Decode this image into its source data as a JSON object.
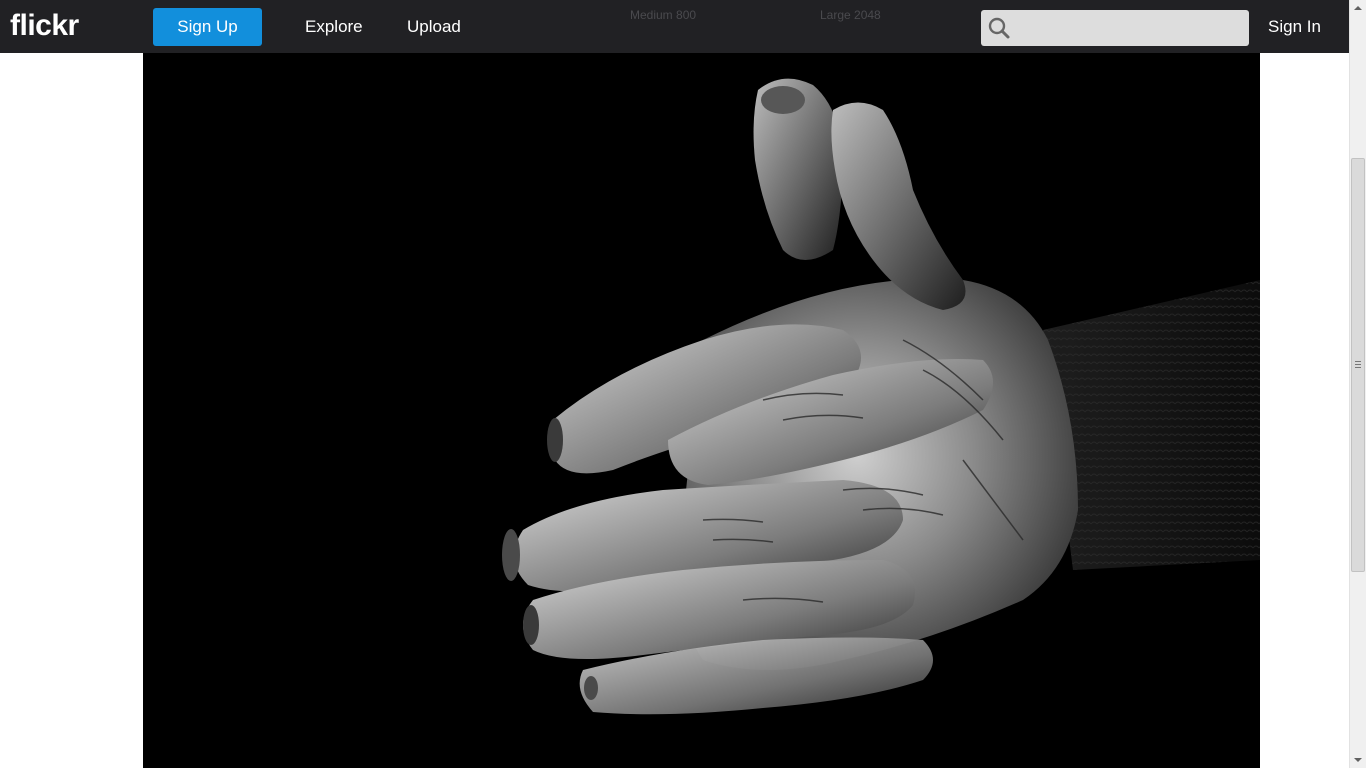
{
  "header": {
    "logo": "flickr",
    "signup_label": "Sign Up",
    "nav": {
      "explore_label": "Explore",
      "upload_label": "Upload"
    },
    "search": {
      "value": "",
      "placeholder": ""
    },
    "signin_label": "Sign In",
    "background_hints": {
      "left": "",
      "middle": "Medium 800",
      "right": "Large 2048"
    }
  },
  "photo": {
    "subject": "black-and-white photo of an elderly person's hands"
  },
  "colors": {
    "topbar": "#212124",
    "signup_button": "#128fdc",
    "photo_background": "#000000"
  }
}
